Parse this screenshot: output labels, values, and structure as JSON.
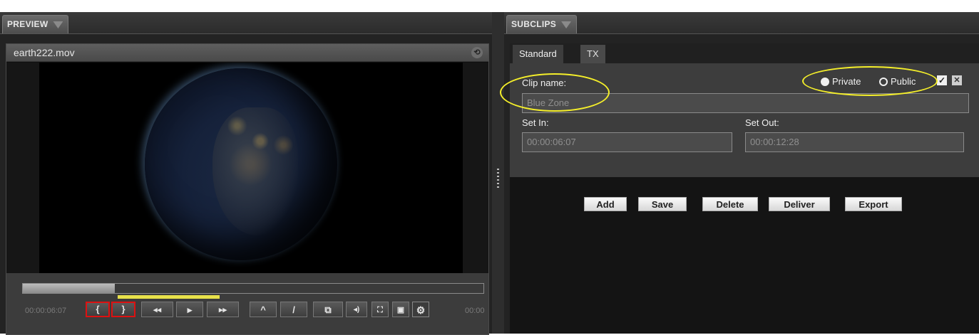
{
  "preview": {
    "header_label": "PREVIEW",
    "file_name": "earth222.mov",
    "timecode_in": "00:00:06:07",
    "timecode_out": "00:00",
    "progress": 0.2,
    "buttons": {
      "mark_in": "{",
      "mark_out": "}",
      "rewind": "◂◂",
      "play": "▸",
      "fast_forward": "▸▸",
      "up": "^",
      "pencil": "/",
      "clip": "⧉",
      "volume": "◂)",
      "fullscreen": "⛶",
      "snapshot": "▣",
      "settings": "⚙"
    }
  },
  "subclips": {
    "header_label": "SUBCLIPS",
    "tabs": [
      {
        "label": "Standard",
        "active": true
      },
      {
        "label": "TX",
        "active": false
      }
    ],
    "clip_name_label": "Clip name:",
    "clip_name_value": "Blue Zone",
    "visibility": {
      "private_label": "Private",
      "public_label": "Public",
      "selected": "Private"
    },
    "set_in_label": "Set In:",
    "set_in_value": "00:00:06:07",
    "set_out_label": "Set Out:",
    "set_out_value": "00:00:12:28",
    "actions": [
      "Add",
      "Save",
      "Delete",
      "Deliver",
      "Export"
    ],
    "checkbox_checked": "✓",
    "checkbox_close": "✕"
  },
  "colors": {
    "highlight": "#f5ef2a",
    "marker_red": "#dd1111",
    "range_yellow": "#e8e14a"
  }
}
